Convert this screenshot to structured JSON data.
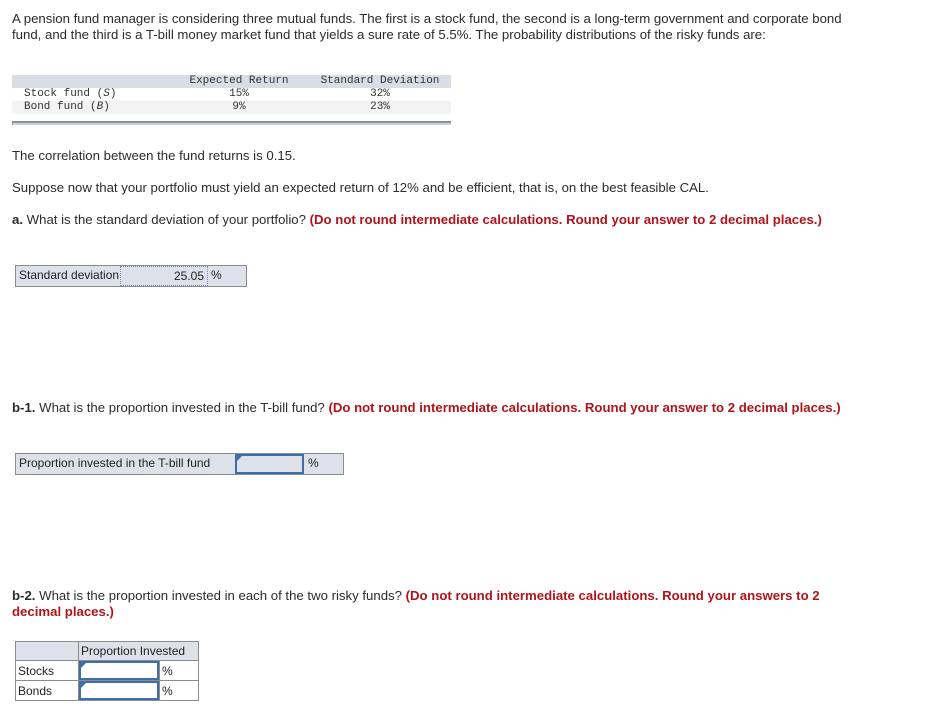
{
  "intro": "A pension fund manager is considering three mutual funds. The first is a stock fund, the second is a long-term government and corporate bond fund, and the third is a T-bill money market fund that yields a sure rate of 5.5%. The probability distributions of the risky funds are:",
  "fund_table": {
    "headers": [
      "",
      "Expected Return",
      "Standard Deviation"
    ],
    "rows": [
      {
        "name": "Stock fund (",
        "symbol": "S",
        "close": ")",
        "expected_return": "15%",
        "std_dev": "32%"
      },
      {
        "name": "Bond fund (",
        "symbol": "B",
        "close": ")",
        "expected_return": "9%",
        "std_dev": "23%"
      }
    ]
  },
  "correlation_text": "The correlation between the fund returns is 0.15.",
  "suppose_text": "Suppose now that your portfolio must yield an expected return of 12% and be efficient, that is, on the best feasible CAL.",
  "part_a": {
    "label": "a.",
    "question": " What is the standard deviation of your portfolio? ",
    "instruction": "(Do not round intermediate calculations. Round your answer to 2 decimal places.)",
    "field_label": "Standard deviation",
    "value": "25.05",
    "unit": "%"
  },
  "part_b1": {
    "label": "b-1.",
    "question": " What is the proportion invested in the T-bill fund? ",
    "instruction": "(Do not round intermediate calculations. Round your answer to 2 decimal places.)",
    "field_label": "Proportion invested in the T-bill fund",
    "value": "",
    "unit": "%"
  },
  "part_b2": {
    "label": "b-2.",
    "question": " What is the proportion invested in each of the two risky funds? ",
    "instruction": "(Do not round intermediate calculations. Round your answers to 2 decimal places.)",
    "column_header": "Proportion Invested",
    "rows": [
      {
        "label": "Stocks",
        "value": "",
        "unit": "%"
      },
      {
        "label": "Bonds",
        "value": "",
        "unit": "%"
      }
    ]
  },
  "colors": {
    "instruction_red": "#b0141a",
    "field_bg": "#dde1ea",
    "input_border": "#3d6ea8"
  }
}
